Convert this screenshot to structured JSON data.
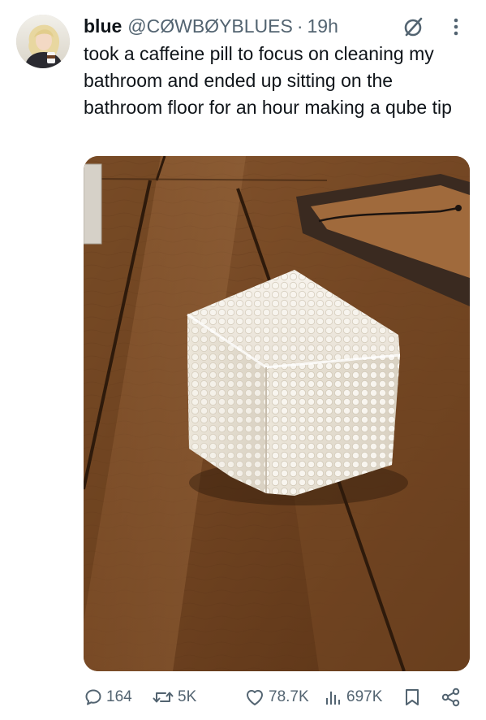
{
  "tweet": {
    "author": {
      "display_name": "blue",
      "handle": "@CØWBØYBLUES",
      "separator": "·",
      "time": "19h"
    },
    "text": "took a caffeine pill to focus on cleaning my bathroom and ended up sitting on the bathroom floor for an hour making a qube tip",
    "media_description_icon": "photo",
    "icons": {
      "verified": "crossed-circle-icon",
      "more": "more-vertical-icon"
    }
  },
  "actions": {
    "reply_count": "164",
    "retweet_count": "5K",
    "like_count": "78.7K",
    "views_count": "697K"
  },
  "colors": {
    "text": "#0f1419",
    "secondary": "#536471",
    "background": "#ffffff"
  }
}
